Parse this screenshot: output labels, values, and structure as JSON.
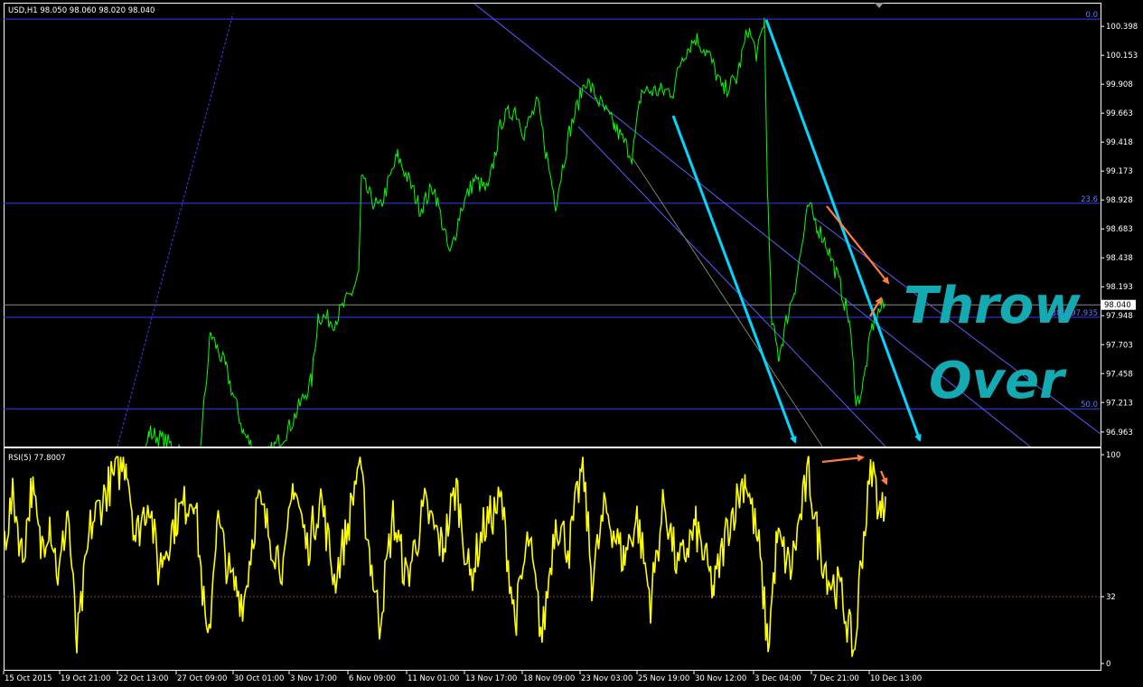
{
  "chart_data": {
    "type": "line",
    "colors": {
      "background": "#000000",
      "price_line": "#00ff00",
      "rsi_line": "#ffff00",
      "frame": "#ffffff",
      "fib_line": "#3a3aff",
      "channel": "#5a5aff",
      "trend_arrow": "#00d8ff",
      "annotation_arrow": "#ff7f3f",
      "annotation_text": "#13aab1"
    },
    "price_panel": {
      "header": "USD,H1  98.050 98.060 98.020 98.040",
      "ylim": [
        96.84,
        100.56
      ],
      "y_ticks": [
        "100.398",
        "100.153",
        "99.908",
        "99.663",
        "99.418",
        "99.173",
        "98.928",
        "98.683",
        "98.438",
        "98.193",
        "97.948",
        "97.703",
        "97.458",
        "97.213",
        "96.963"
      ],
      "current_price": "98.040",
      "current_value": 98.04,
      "fib_levels": [
        {
          "label": "0.0",
          "value": 100.46
        },
        {
          "label": "23.6",
          "value": 98.9
        },
        {
          "label": "38.2 97.935",
          "value": 97.935
        },
        {
          "label": "50.0",
          "value": 97.16
        }
      ],
      "series_anchors": [
        [
          0,
          96.4
        ],
        [
          160,
          96.75
        ],
        [
          165,
          96.96
        ],
        [
          180,
          96.9
        ],
        [
          220,
          96.7
        ],
        [
          233,
          97.8
        ],
        [
          250,
          97.5
        ],
        [
          270,
          96.95
        ],
        [
          290,
          96.7
        ],
        [
          320,
          97.0
        ],
        [
          345,
          97.4
        ],
        [
          352,
          97.95
        ],
        [
          370,
          97.9
        ],
        [
          390,
          98.15
        ],
        [
          397,
          98.3
        ],
        [
          400,
          99.1
        ],
        [
          410,
          98.95
        ],
        [
          420,
          98.85
        ],
        [
          440,
          99.3
        ],
        [
          455,
          99.05
        ],
        [
          465,
          98.85
        ],
        [
          480,
          99.05
        ],
        [
          498,
          98.45
        ],
        [
          510,
          98.85
        ],
        [
          525,
          99.1
        ],
        [
          540,
          99.0
        ],
        [
          555,
          99.6
        ],
        [
          570,
          99.7
        ],
        [
          580,
          99.5
        ],
        [
          595,
          99.75
        ],
        [
          605,
          99.3
        ],
        [
          615,
          98.9
        ],
        [
          630,
          99.5
        ],
        [
          648,
          99.95
        ],
        [
          660,
          99.8
        ],
        [
          680,
          99.55
        ],
        [
          700,
          99.3
        ],
        [
          710,
          99.85
        ],
        [
          730,
          99.85
        ],
        [
          745,
          99.85
        ],
        [
          755,
          100.15
        ],
        [
          770,
          100.3
        ],
        [
          785,
          100.15
        ],
        [
          800,
          99.85
        ],
        [
          815,
          99.95
        ],
        [
          828,
          100.38
        ],
        [
          838,
          100.15
        ],
        [
          846,
          100.45
        ],
        [
          848,
          99.6
        ],
        [
          850,
          98.85
        ],
        [
          854,
          97.9
        ],
        [
          862,
          97.6
        ],
        [
          870,
          97.9
        ],
        [
          880,
          98.2
        ],
        [
          895,
          98.88
        ],
        [
          905,
          98.7
        ],
        [
          915,
          98.55
        ],
        [
          930,
          98.2
        ],
        [
          940,
          97.9
        ],
        [
          948,
          97.2
        ],
        [
          955,
          97.35
        ],
        [
          965,
          97.85
        ],
        [
          972,
          97.98
        ],
        [
          980,
          98.04
        ]
      ]
    },
    "rsi_panel": {
      "header": "RSI(5) 77.8007",
      "ylim": [
        0,
        100
      ],
      "y_ticks": [
        "100",
        "32",
        "0"
      ],
      "level": 32,
      "series_anchors": [
        [
          5,
          60
        ],
        [
          15,
          80
        ],
        [
          25,
          50
        ],
        [
          35,
          85
        ],
        [
          45,
          55
        ],
        [
          55,
          70
        ],
        [
          65,
          40
        ],
        [
          75,
          75
        ],
        [
          85,
          8
        ],
        [
          100,
          65
        ],
        [
          120,
          85
        ],
        [
          140,
          98
        ],
        [
          150,
          60
        ],
        [
          165,
          80
        ],
        [
          175,
          45
        ],
        [
          195,
          70
        ],
        [
          215,
          82
        ],
        [
          230,
          5
        ],
        [
          240,
          70
        ],
        [
          255,
          40
        ],
        [
          270,
          30
        ],
        [
          285,
          78
        ],
        [
          300,
          60
        ],
        [
          315,
          45
        ],
        [
          325,
          88
        ],
        [
          340,
          55
        ],
        [
          355,
          80
        ],
        [
          370,
          40
        ],
        [
          385,
          65
        ],
        [
          397,
          97
        ],
        [
          410,
          50
        ],
        [
          420,
          20
        ],
        [
          435,
          70
        ],
        [
          450,
          40
        ],
        [
          470,
          75
        ],
        [
          490,
          55
        ],
        [
          505,
          85
        ],
        [
          520,
          40
        ],
        [
          535,
          65
        ],
        [
          555,
          78
        ],
        [
          570,
          20
        ],
        [
          585,
          60
        ],
        [
          600,
          12
        ],
        [
          615,
          70
        ],
        [
          630,
          55
        ],
        [
          645,
          96
        ],
        [
          655,
          40
        ],
        [
          670,
          75
        ],
        [
          690,
          50
        ],
        [
          705,
          70
        ],
        [
          720,
          30
        ],
        [
          735,
          78
        ],
        [
          750,
          45
        ],
        [
          770,
          65
        ],
        [
          790,
          35
        ],
        [
          805,
          65
        ],
        [
          825,
          90
        ],
        [
          840,
          55
        ],
        [
          850,
          8
        ],
        [
          860,
          60
        ],
        [
          875,
          45
        ],
        [
          895,
          92
        ],
        [
          905,
          60
        ],
        [
          918,
          40
        ],
        [
          930,
          35
        ],
        [
          940,
          15
        ],
        [
          946,
          5
        ],
        [
          953,
          50
        ],
        [
          965,
          95
        ],
        [
          975,
          70
        ],
        [
          980,
          80
        ]
      ]
    },
    "x_ticks": [
      "15 Oct 2015",
      "19 Oct 21:00",
      "22 Oct 13:00",
      "27 Oct 09:00",
      "30 Oct 01:00",
      "3 Nov 17:00",
      "6 Nov 09:00",
      "11 Nov 01:00",
      "13 Nov 17:00",
      "18 Nov 09:00",
      "23 Nov 03:00",
      "25 Nov 19:00",
      "30 Nov 12:00",
      "3 Dec 04:00",
      "7 Dec 21:00",
      "10 Dec 13:00"
    ],
    "annotation": {
      "line1": "Throw",
      "line2": "Over"
    }
  }
}
